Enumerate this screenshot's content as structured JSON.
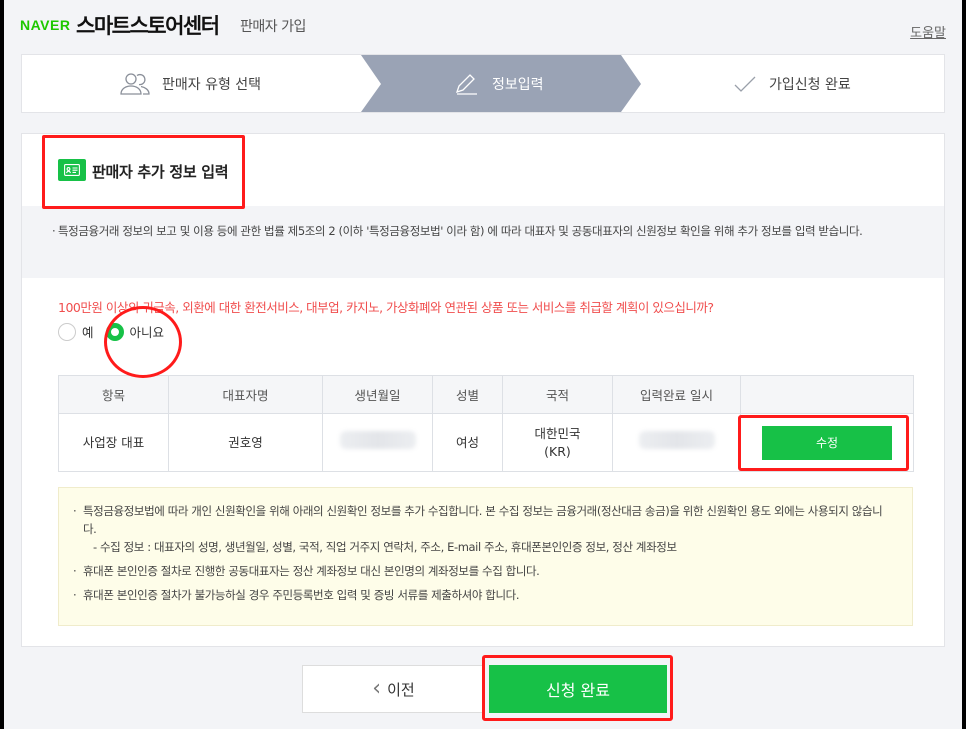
{
  "header": {
    "naver_logo": "NAVER",
    "store_title": "스마트스토어센터",
    "subtitle": "판매자 가입",
    "help_link": "도움말"
  },
  "stepper": {
    "steps": [
      {
        "label": "판매자 유형 선택",
        "icon": "people-icon",
        "active": false
      },
      {
        "label": "정보입력",
        "icon": "pencil-icon",
        "active": true
      },
      {
        "label": "가입신청 완료",
        "icon": "check-icon",
        "active": false
      }
    ]
  },
  "panel": {
    "title": "판매자 추가 정보 입력",
    "title_icon": "id-card-icon",
    "notice": "특정금융거래 정보의 보고 및 이용 등에 관한 법률 제5조의 2 (이하 '특정금융정보법' 이라 함) 에 따라 대표자 및 공동대표자의 신원정보 확인을 위해 추가 정보를 입력 받습니다.",
    "question": "100만원 이상의 귀금속, 외환에 대한 환전서비스, 대부업, 카지노, 가상화폐와 연관된 상품 또는 서비스를 취급할 계획이 있으십니까?",
    "radio_yes": "예",
    "radio_no": "아니요",
    "radio_selected": "아니요"
  },
  "table": {
    "headers": [
      "항목",
      "대표자명",
      "생년월일",
      "성별",
      "국적",
      "입력완료 일시",
      ""
    ],
    "row": {
      "type": "사업장 대표",
      "name": "권호영",
      "gender": "여성",
      "nationality_line1": "대한민국",
      "nationality_line2": "(KR)",
      "edit_label": "수정"
    }
  },
  "info_box": {
    "item1": "특정금융정보법에 따라 개인 신원확인을 위해 아래의 신원확인 정보를 추가 수집합니다. 본 수집 정보는 금융거래(정산대금 송금)을 위한 신원확인 용도 외에는 사용되지 않습니다.",
    "item1_sub": "- 수집 정보 : 대표자의 성명, 생년월일, 성별, 국적, 직업 거주지 연락처, 주소, E-mail 주소, 휴대폰본인인증 정보, 정산 계좌정보",
    "item2": "휴대폰 본인인증 절차로 진행한 공동대표자는 정산 계좌정보 대신 본인명의 계좌정보를 수집 합니다.",
    "item3": "휴대폰 본인인증 절차가 불가능하실 경우 주민등록번호 입력 및 증빙 서류를 제출하셔야 합니다."
  },
  "buttons": {
    "prev_arrow": "‹",
    "prev_label": "이전",
    "submit_label": "신청 완료"
  },
  "colors": {
    "naver_green": "#1ec800",
    "button_green": "#17c147",
    "active_step": "#9aa3b5",
    "question_red": "#f04e4e",
    "annotation_red": "#ff1b1b"
  }
}
